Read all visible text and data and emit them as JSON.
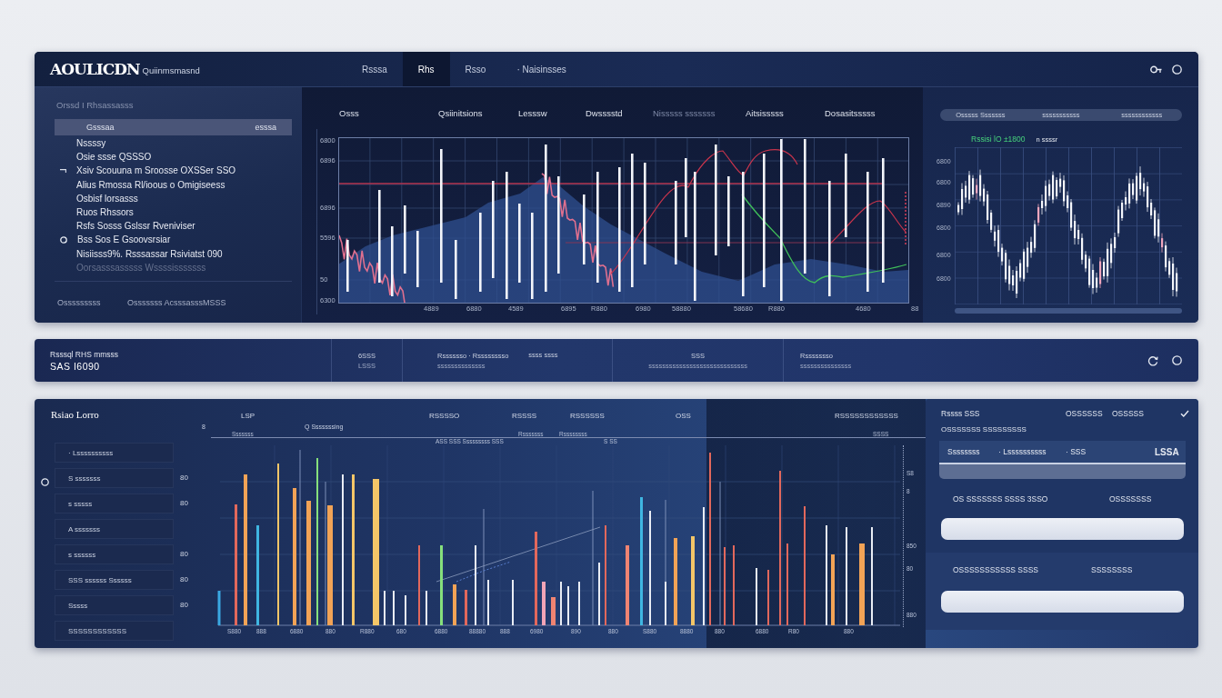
{
  "header": {
    "logo": "AOULICDN",
    "subtitle": "Quiinmsmasnd",
    "tabs": [
      {
        "label": "Rsssa",
        "selected": false
      },
      {
        "label": "Rhs",
        "selected": true
      },
      {
        "label": "Rsso",
        "selected": false
      },
      {
        "label": "· Naisinsses",
        "selected": false
      }
    ]
  },
  "sidebar": {
    "heading": "Orssd I Rhsassasss",
    "items": [
      {
        "label": "Gsssaa",
        "value": "esssa",
        "kind": "plain",
        "selected": true,
        "disabled": false
      },
      {
        "label": "Nssssy",
        "kind": "plain",
        "selected": false,
        "disabled": false
      },
      {
        "label": "Osie ssse QSSSO",
        "kind": "plain",
        "selected": false,
        "disabled": false
      },
      {
        "label": "Xsiv Scouuna m Sroosse OXSSer SSO",
        "kind": "hook",
        "selected": false,
        "disabled": false
      },
      {
        "label": "Alius Rmossa Rl/ioous o Omigiseess",
        "kind": "plain",
        "selected": false,
        "disabled": false
      },
      {
        "label": "Osbisf lorsasss",
        "kind": "plain",
        "selected": false,
        "disabled": false
      },
      {
        "label": "Ruos Rhssors",
        "kind": "plain",
        "selected": false,
        "disabled": false
      },
      {
        "label": "Rsfs Sosss Gslssr Rveniviser",
        "kind": "plain",
        "selected": false,
        "disabled": false
      },
      {
        "label": "Bss Sos E Gsoovsrsiar",
        "kind": "ring",
        "selected": false,
        "disabled": false
      },
      {
        "label": "Nisiisss9%. Rsssassar Rsiviatst 090",
        "kind": "plain",
        "selected": false,
        "disabled": false
      },
      {
        "label": "Oorsasssasssss Wssssisssssss",
        "kind": "plain",
        "selected": false,
        "disabled": true
      }
    ],
    "footer": [
      "Osssssssss",
      "Osssssss AcsssasssMSSS"
    ]
  },
  "main_chart": {
    "columns": [
      {
        "label": "Osss",
        "dimmed": false
      },
      {
        "label": "Qsiinitsions",
        "dimmed": false
      },
      {
        "label": "Lesssw",
        "dimmed": false
      },
      {
        "label": "Dwsssstd",
        "dimmed": false
      },
      {
        "label": "Nisssss sssssss",
        "dimmed": true
      },
      {
        "label": "Aitsisssss",
        "dimmed": false
      },
      {
        "label": "Dosasitsssss",
        "dimmed": false
      }
    ],
    "y_labels": [
      "6800",
      "6896",
      "6896",
      "5596",
      "50",
      "6300"
    ],
    "x_labels": [
      "4889",
      "6880",
      "4589",
      "6895",
      "R880",
      "6980",
      "58880",
      "58680",
      "R880",
      "4680",
      "88"
    ]
  },
  "mini_chart": {
    "segments": [
      "Osssss Sssssss",
      "sssssssssss",
      "ssssssssssss"
    ],
    "legend": "Rssisi lO ±1800",
    "legend_note": "n ssssr",
    "y_labels": [
      "6800",
      "6800",
      "6890",
      "6800",
      "6800",
      "6800"
    ]
  },
  "summary_bar": {
    "title": "Rsssql RHS mmsss",
    "subtitle": "SAS I6090",
    "groups": [
      {
        "items": [
          {
            "label": "6SSS",
            "value": "LSSS"
          }
        ]
      },
      {
        "items": [
          {
            "label": "Rsssssso · Rsssssssso",
            "value": "ssssssssssssss"
          },
          {
            "label": "ssss ssss"
          }
        ]
      },
      {
        "items": [
          {
            "label": "SSS",
            "value": "sssssssssssssssssssssssssssss"
          }
        ]
      },
      {
        "items": [
          {
            "label": "Rssssssso",
            "value": "sssssssssssssss"
          }
        ]
      }
    ]
  },
  "bottom_panel": {
    "title": "Rsiao Lorro",
    "items": [
      {
        "label": "· Lssssssssss"
      },
      {
        "label": "S sssssss",
        "value": "80"
      },
      {
        "label": "s sssss",
        "value": "80"
      },
      {
        "label": "A sssssss"
      },
      {
        "label": "s ssssss",
        "value": "80"
      },
      {
        "label": "SSS ssssss Ssssss",
        "value": "80"
      },
      {
        "label": "Sssss",
        "value": "80"
      },
      {
        "label": "SSSSSSSSSSSS"
      }
    ],
    "chart": {
      "headers": [
        "LSP",
        "RSSSSO",
        "RSSSS",
        "RSSSSSS",
        "OSS",
        "RSSSSSSSSSSSS"
      ],
      "marker": "8",
      "subtitle": "Q Sssssssing",
      "line_labels": [
        "Sssssss",
        "Rsssssss",
        "Rssssssss",
        "SSSS"
      ],
      "notes": [
        "ASS SSS Sssssssss SSS",
        "S SS"
      ],
      "scale_labels": [
        "S8",
        "8",
        "850",
        "80",
        "880"
      ],
      "x_labels": [
        "S880",
        "888",
        "6880",
        "880",
        "R880",
        "680",
        "6880",
        "88880",
        "888",
        "6980",
        "890",
        "880",
        "S880",
        "8880",
        "880",
        "6880",
        "R80",
        "880"
      ]
    }
  },
  "form": {
    "title": "Rssss SSS",
    "options": [
      "OSSSSSS",
      "OSSSSS"
    ],
    "caption": "OSSSSSSS SSSSSSSSS",
    "value_row": [
      "Ssssssss",
      "· Lssssssssss",
      "· SSS",
      "LSSA"
    ],
    "fields": [
      {
        "label": "OS SSSSSSS SSSS 3SSO",
        "note": "OSSSSSSS"
      },
      {
        "label": "OSSSSSSSSSSS SSSS",
        "note": "SSSSSSSS"
      }
    ]
  }
}
